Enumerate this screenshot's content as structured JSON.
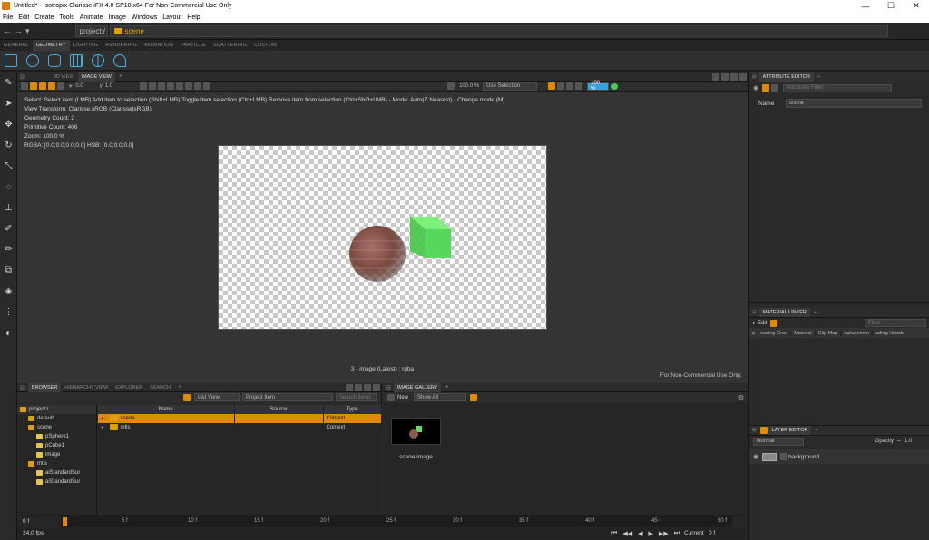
{
  "window": {
    "title": "Untitled* - Isotropix Clarisse iFX 4.0 SP10 x64  For Non-Commercial Use Only"
  },
  "menu": [
    "File",
    "Edit",
    "Create",
    "Tools",
    "Animate",
    "Image",
    "Windows",
    "Layout",
    "Help"
  ],
  "path": {
    "root": "project:/",
    "context": "scene"
  },
  "shelf_tabs": [
    "GENERAL",
    "GEOMETRY",
    "LIGHTING",
    "RENDERING",
    "ANIMATION",
    "PARTICLE",
    "SCATTERING",
    "CUSTOM"
  ],
  "shelf_icons": [
    "cube-icon",
    "sphere-icon",
    "cylinder-icon",
    "grid-icon",
    "globe-icon",
    "spiral-icon"
  ],
  "viewport": {
    "tabs": [
      "3D VIEW",
      "IMAGE VIEW"
    ],
    "exposure": "0.0",
    "gamma": "1.0",
    "zoom_select": "100.0 %",
    "selection_mode": "Use Selection",
    "zoom_right": "100 %",
    "info": [
      "Select: Select item (LMB)  Add item to selection (Shift+LMB)  Toggle item selection (Ctrl+LMB)  Remove item from selection (Ctrl+Shift+LMB)  - Mode: Auto(Z Nearest)  - Change mode (M)",
      "View Transform: Clarisse.sRGB (Clarisse|sRGB)",
      "Geometry Count: 2",
      "Primitive Count: 406",
      "Zoom: 100.0 %",
      "RGBA: [0.0;0.0;0.0;0.0] HSB: [0.0;0.0;0.0]"
    ],
    "caption": "3 - image (Latest) : rgba",
    "watermark": "For Non-Commercial Use Only."
  },
  "browser": {
    "tabs": [
      "BROWSER",
      "HIERARCHY VIEW",
      "EXPLORER",
      "SEARCH"
    ],
    "view_mode": "List View",
    "project_item": "Project Item",
    "search_placeholder": "Search items",
    "tree": [
      {
        "label": "project:/",
        "depth": 0
      },
      {
        "label": "default",
        "depth": 1
      },
      {
        "label": "scene",
        "depth": 1
      },
      {
        "label": "pSphere1",
        "depth": 2
      },
      {
        "label": "pCube1",
        "depth": 2
      },
      {
        "label": "image",
        "depth": 2
      },
      {
        "label": "mtls",
        "depth": 1
      },
      {
        "label": "aiStandardSur",
        "depth": 2
      },
      {
        "label": "aiStandardSur",
        "depth": 2
      }
    ],
    "columns": [
      "Name",
      "Source",
      "Type"
    ],
    "rows": [
      {
        "name": "scene",
        "source": "",
        "type": "Context"
      },
      {
        "name": "mtls",
        "source": "",
        "type": "Context"
      }
    ]
  },
  "gallery": {
    "tab": "IMAGE GALLERY",
    "new_label": "New",
    "show": "Show All",
    "thumb_label": "scene/image"
  },
  "attribute_editor": {
    "tab": "ATTRIBUTE EDITOR",
    "filter_placeholder": "Attributes Filter",
    "name_label": "Name",
    "name_value": "scene"
  },
  "material_linker": {
    "tab": "MATERIAL LINKER",
    "edit": "Edit",
    "filter_placeholder": "Filter",
    "columns": [
      "eading Grou",
      "Material",
      "Clip Map",
      "isplacemen",
      "ading Variab"
    ]
  },
  "layer_editor": {
    "tab": "LAYER EDITOR",
    "blend": "Normal",
    "opacity_label": "Opacity",
    "opacity_value": "1.0",
    "layer": "background"
  },
  "timeline": {
    "start": "0 f",
    "end": "50 f",
    "ticks": [
      "5 f",
      "10 f",
      "15 f",
      "20 f",
      "25 f",
      "30 f",
      "35 f",
      "40 f",
      "45 f",
      "50 f"
    ],
    "fps": "24.0 fps",
    "current_label": "Current",
    "current_value": "0 f"
  },
  "colors": {
    "accent": "#e08a00",
    "green": "#3fd05a",
    "blue": "#3fb0e8"
  }
}
